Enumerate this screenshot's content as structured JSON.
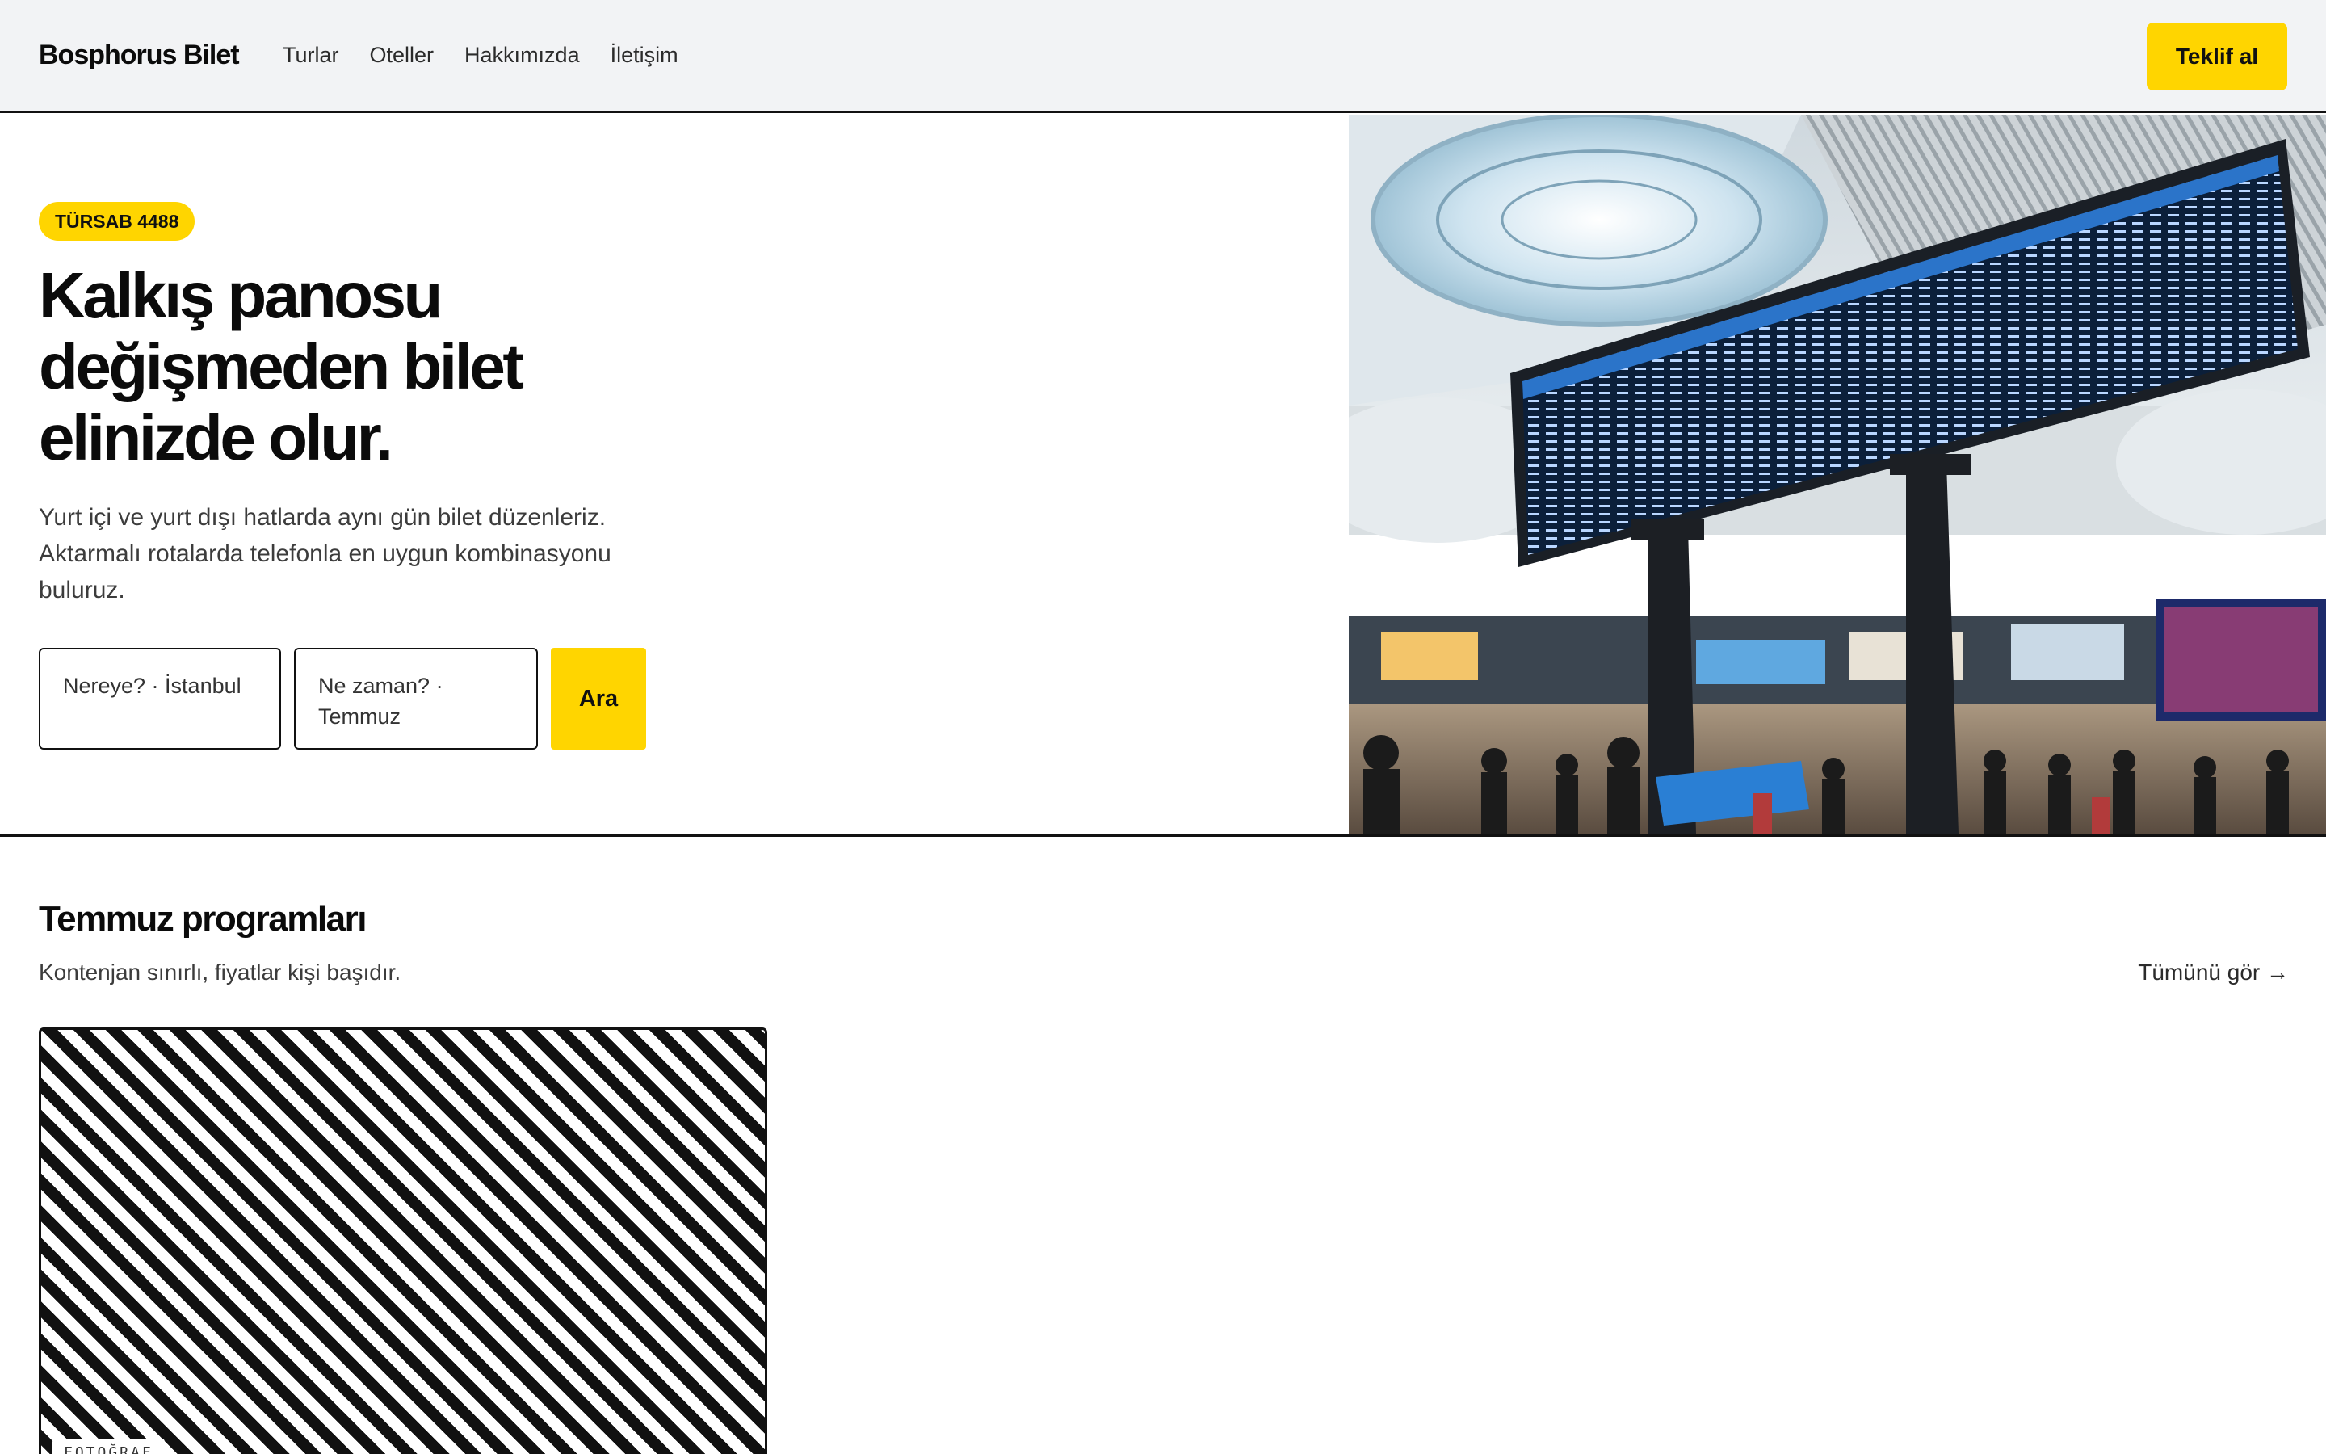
{
  "brand": "Bosphorus Bilet",
  "nav": [
    "Turlar",
    "Oteller",
    "Hakkımızda",
    "İletişim"
  ],
  "header": {
    "cta_label": "Teklif al"
  },
  "hero": {
    "badge": "TÜRSAB 4488",
    "headline": "Kalkış panosu değişmeden bilet elinizde olur.",
    "subtext": "Yurt içi ve yurt dışı hatlarda aynı gün bilet düzenleriz. Aktarmalı rotalarda telefonla en uygun kombinasyonu buluruz.",
    "destination_field": "Nereye? · İstanbul",
    "date_field": "Ne zaman? · Temmuz",
    "search_label": "Ara"
  },
  "programs": {
    "title": "Temmuz programları",
    "subtitle": "Kontenjan sınırlı, fiyatlar kişi başıdır.",
    "see_all": "Tümünü gör →",
    "card_tag": "FOTOĞRAF"
  },
  "colors": {
    "accent": "#ffd500",
    "ink": "#111111",
    "header_bg": "#f2f3f5"
  }
}
